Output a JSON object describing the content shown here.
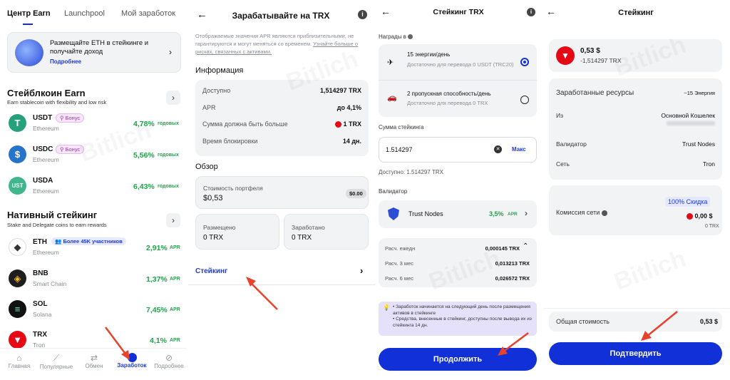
{
  "screen1": {
    "tabs": [
      "Центр Earn",
      "Launchpool",
      "Мой заработок"
    ],
    "banner": {
      "text": "Размещайте ETH в стейкинге и получайте доход",
      "link": "Подробнее"
    },
    "stable": {
      "title": "Стейблкоин Earn",
      "subtitle": "Earn stablecoin with flexibility and low risk",
      "items": [
        {
          "symbol": "USDT",
          "network": "Ethereum",
          "badge": "Бонус",
          "rate": "4,78%",
          "unit": "годовых",
          "color": "#26a17b"
        },
        {
          "symbol": "USDC",
          "network": "Ethereum",
          "badge": "Бонус",
          "rate": "5,56%",
          "unit": "годовых",
          "color": "#2775ca"
        },
        {
          "symbol": "USDA",
          "network": "Ethereum",
          "badge": "",
          "rate": "6,43%",
          "unit": "годовых",
          "color": "#3fb68b"
        }
      ]
    },
    "native": {
      "title": "Нативный стейкинг",
      "subtitle": "Stake and Delegate coins to earn rewards",
      "items": [
        {
          "symbol": "ETH",
          "network": "Ethereum",
          "badge": "Более 45K участников",
          "rate": "2,91%",
          "unit": "APR",
          "color": "#3c3c3d"
        },
        {
          "symbol": "BNB",
          "network": "Smart Chain",
          "badge": "",
          "rate": "1,37%",
          "unit": "APR",
          "color": "#1e1e1e"
        },
        {
          "symbol": "SOL",
          "network": "Solana",
          "badge": "",
          "rate": "7,45%",
          "unit": "APR",
          "color": "#111111"
        },
        {
          "symbol": "TRX",
          "network": "Tron",
          "badge": "",
          "rate": "4,1%",
          "unit": "APR",
          "color": "#e50915"
        }
      ]
    },
    "nav": [
      "Главная",
      "Популярные",
      "Обмен",
      "Заработок",
      "Подробнее"
    ]
  },
  "screen2": {
    "title": "Зарабатывайте на TRX",
    "disclaimer": "Отображаемые значения APR являются приблизительными, не гарантируются и могут меняться со временем.",
    "disclaimer_link": "Узнайте больше о рисках, связанных с активами.",
    "info_title": "Информация",
    "info": [
      {
        "label": "Доступно",
        "value": "1,514297 TRX"
      },
      {
        "label": "APR",
        "value": "до 4,1%"
      },
      {
        "label": "Сумма должна быть больше",
        "value": "1 TRX"
      },
      {
        "label": "Время блокировки",
        "value": "14 дн."
      }
    ],
    "overview_title": "Обзор",
    "portfolio_label": "Стоимость портфеля",
    "portfolio_value": "$0,53",
    "portfolio_badge": "$0.00",
    "placed_label": "Размещено",
    "placed_value": "0 TRX",
    "earned_label": "Заработано",
    "earned_value": "0 TRX",
    "staking_link": "Стейкинг"
  },
  "screen3": {
    "title": "Стейкинг TRX",
    "rewards_label": "Награды в",
    "options": [
      {
        "title": "15 энергии/день",
        "desc": "Достаточно для перевода 0 USDT (TRC20)",
        "selected": true
      },
      {
        "title": "2 пропускная способность/день",
        "desc": "Достаточно для перевода 0 TRX",
        "selected": false
      }
    ],
    "amount_label": "Сумма стейкинга",
    "amount_value": "1.514297",
    "max_label": "Макс",
    "available": "Доступно: 1.514297 TRX",
    "validator_label": "Валидатор",
    "validator_name": "Trust Nodes",
    "validator_rate": "3,5%",
    "validator_unit": "APR",
    "estimates": [
      {
        "label": "Расч. ежедн",
        "value": "0,000145 TRX"
      },
      {
        "label": "Расч. 3 мес",
        "value": "0,013213 TRX"
      },
      {
        "label": "Расч. 6 мес",
        "value": "0,026572 TRX"
      }
    ],
    "notice": [
      "• Заработок начинается на следующий день после размещения активов в стейкинге",
      "• Средства, внесенные в стейкинг, доступны после вывода их из стейкинга 14 дн."
    ],
    "continue_label": "Продолжить"
  },
  "screen4": {
    "title": "Стейкинг",
    "amount_usd": "0,53 $",
    "amount_trx": "-1,514297 TRX",
    "rows": [
      {
        "label": "Заработанные ресурсы",
        "value": "~15 Энергия"
      },
      {
        "label": "Из",
        "value": "Основной Кошелек"
      },
      {
        "label": "Валидатор",
        "value": "Trust Nodes"
      },
      {
        "label": "Сеть",
        "value": "Tron"
      }
    ],
    "fee_label": "Комиссия сети",
    "fee_badge": "100% Скидка",
    "fee_usd": "0,00 $",
    "fee_trx": "0 TRX",
    "total_label": "Общая стоимость",
    "total_value": "0,53 $",
    "confirm_label": "Подтвердить"
  },
  "watermark": "Bitlich",
  "colors": {
    "primary": "#1230d8",
    "green": "#20a34a",
    "trx": "#e50915",
    "card": "#f2f3f5"
  }
}
